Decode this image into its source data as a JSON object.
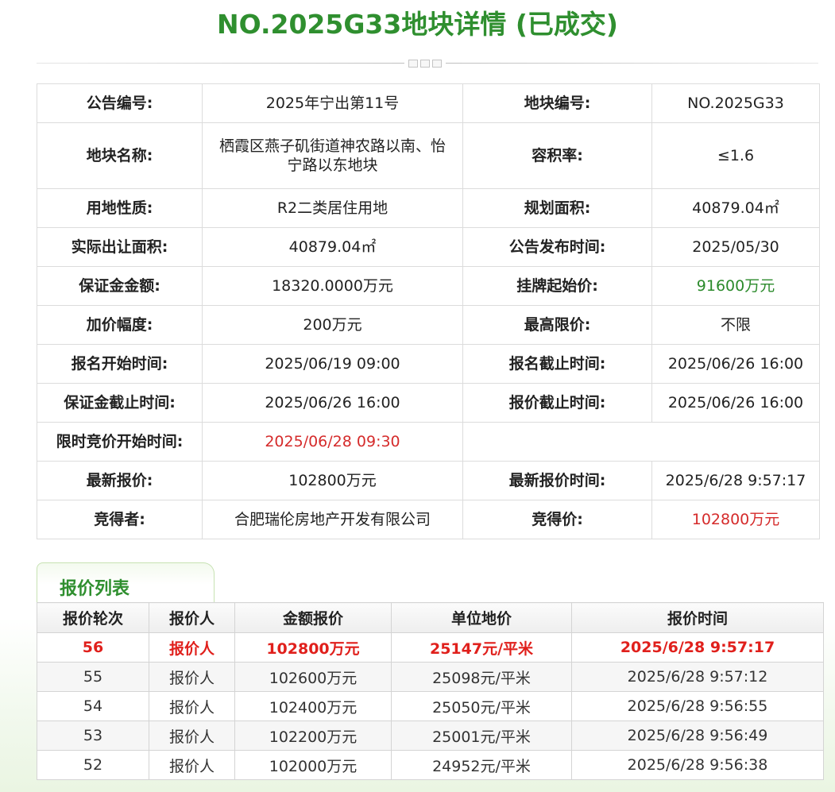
{
  "page_title": "NO.2025G33地块详情 (已成交)",
  "detail_rows": [
    {
      "k1": "公告编号:",
      "v1": "2025年宁出第11号",
      "k2": "地块编号:",
      "v2": "NO.2025G33"
    },
    {
      "k1": "地块名称:",
      "v1": "栖霞区燕子矶街道神农路以南、怡宁路以东地块",
      "k2": "容积率:",
      "v2": "≤1.6"
    },
    {
      "k1": "用地性质:",
      "v1": "R2二类居住用地",
      "k2": "规划面积:",
      "v2": "40879.04㎡"
    },
    {
      "k1": "实际出让面积:",
      "v1": "40879.04㎡",
      "k2": "公告发布时间:",
      "v2": "2025/05/30"
    },
    {
      "k1": "保证金金额:",
      "v1": "18320.0000万元",
      "k2": "挂牌起始价:",
      "v2": "91600万元"
    },
    {
      "k1": "加价幅度:",
      "v1": "200万元",
      "k2": "最高限价:",
      "v2": "不限"
    },
    {
      "k1": "报名开始时间:",
      "v1": "2025/06/19 09:00",
      "k2": "报名截止时间:",
      "v2": "2025/06/26 16:00"
    },
    {
      "k1": "保证金截止时间:",
      "v1": "2025/06/26 16:00",
      "k2": "报价截止时间:",
      "v2": "2025/06/26 16:00"
    },
    {
      "k1": "限时竞价开始时间:",
      "v1": "2025/06/28 09:30",
      "k2": "",
      "v2": ""
    },
    {
      "k1": "最新报价:",
      "v1": "102800万元",
      "k2": "最新报价时间:",
      "v2": "2025/6/28 9:57:17"
    },
    {
      "k1": "竞得者:",
      "v1": "合肥瑞伦房地产开发有限公司",
      "k2": "竞得价:",
      "v2": "102800万元"
    }
  ],
  "bid_tab": {
    "label": "报价列表"
  },
  "bid_table": {
    "headers": [
      "报价轮次",
      "报价人",
      "金额报价",
      "单位地价",
      "报价时间"
    ],
    "rows": [
      [
        "56",
        "报价人",
        "102800万元",
        "25147元/平米",
        "2025/6/28 9:57:17"
      ],
      [
        "55",
        "报价人",
        "102600万元",
        "25098元/平米",
        "2025/6/28 9:57:12"
      ],
      [
        "54",
        "报价人",
        "102400万元",
        "25050元/平米",
        "2025/6/28 9:56:55"
      ],
      [
        "53",
        "报价人",
        "102200万元",
        "25001元/平米",
        "2025/6/28 9:56:49"
      ],
      [
        "52",
        "报价人",
        "102000万元",
        "24952元/平米",
        "2025/6/28 9:56:38"
      ]
    ]
  },
  "colors": {
    "title_green": "#2f8f2f",
    "start_price_green": "#2b8a2b",
    "highlight_red": "#d52b2b",
    "latest_bid_red": "#e0201c"
  }
}
